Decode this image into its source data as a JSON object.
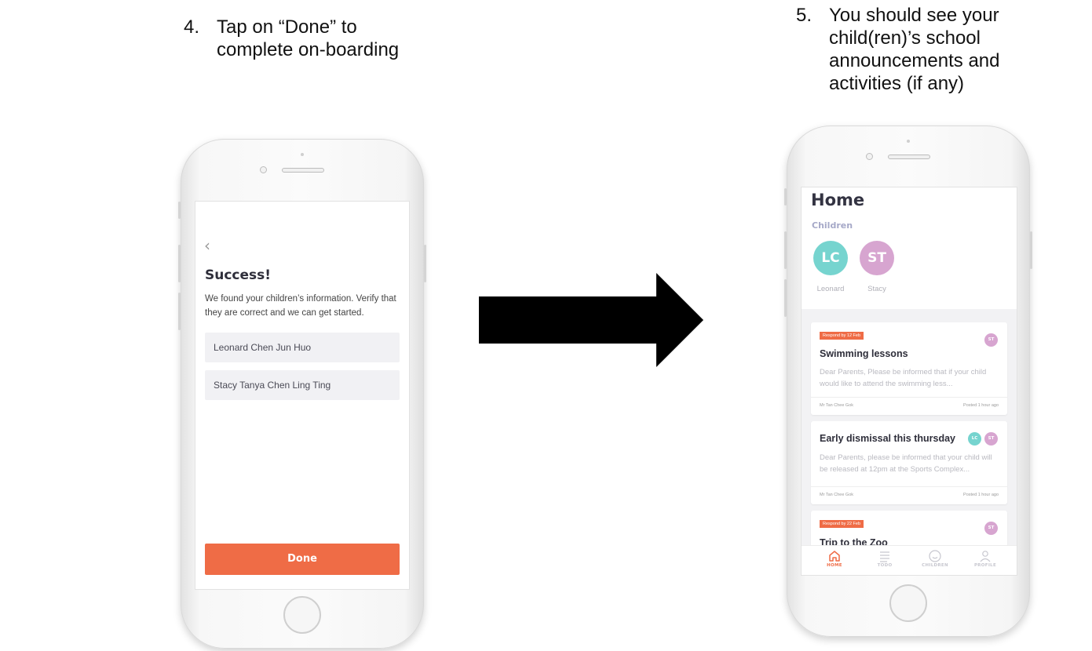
{
  "steps": [
    {
      "num": "4.",
      "text": "Tap on “Done” to\ncomplete on-boarding"
    },
    {
      "num": "5.",
      "text": "You should see your\nchild(ren)’s school\nannouncements and\nactivities (if any)"
    }
  ],
  "onboarding_screen": {
    "back_icon": "chevron-left-icon",
    "title": "Success!",
    "message": "We found your children’s information. Verify that they are correct and we can get started.",
    "children": [
      "Leonard Chen Jun Huo",
      "Stacy Tanya Chen Ling Ting"
    ],
    "done_label": "Done",
    "accent_color": "#ef6c46"
  },
  "home_screen": {
    "title": "Home",
    "children_label": "Children",
    "children": [
      {
        "initials": "LC",
        "name": "Leonard",
        "color": "#76d4cf"
      },
      {
        "initials": "ST",
        "name": "Stacy",
        "color": "#d7a5d0"
      }
    ],
    "cards": [
      {
        "badge": "Respond by 12 Feb",
        "title": "Swimming lessons",
        "body": "Dear Parents, Please be informed that if your child would like to attend the swimming less...",
        "author": "Mr Tan Chee Gok",
        "posted": "Posted 1 hour ago",
        "avatars": [
          "ST"
        ]
      },
      {
        "title": "Early dismissal this thursday",
        "body": "Dear Parents, please be informed that your child will be released at 12pm at the Sports Complex...",
        "author": "Mr Tan Chee Gok",
        "posted": "Posted 1 hour ago",
        "avatars": [
          "LC",
          "ST"
        ]
      },
      {
        "badge": "Respond by 22 Feb",
        "title": "Trip to the Zoo",
        "avatars": [
          "ST"
        ]
      }
    ],
    "tabs": [
      {
        "label": "HOME",
        "icon": "home-icon",
        "active": true
      },
      {
        "label": "TODO",
        "icon": "list-icon",
        "active": false
      },
      {
        "label": "CHILDREN",
        "icon": "smiley-icon",
        "active": false
      },
      {
        "label": "PROFILE",
        "icon": "person-icon",
        "active": false
      }
    ]
  },
  "arrow_icon": "right-arrow-icon"
}
